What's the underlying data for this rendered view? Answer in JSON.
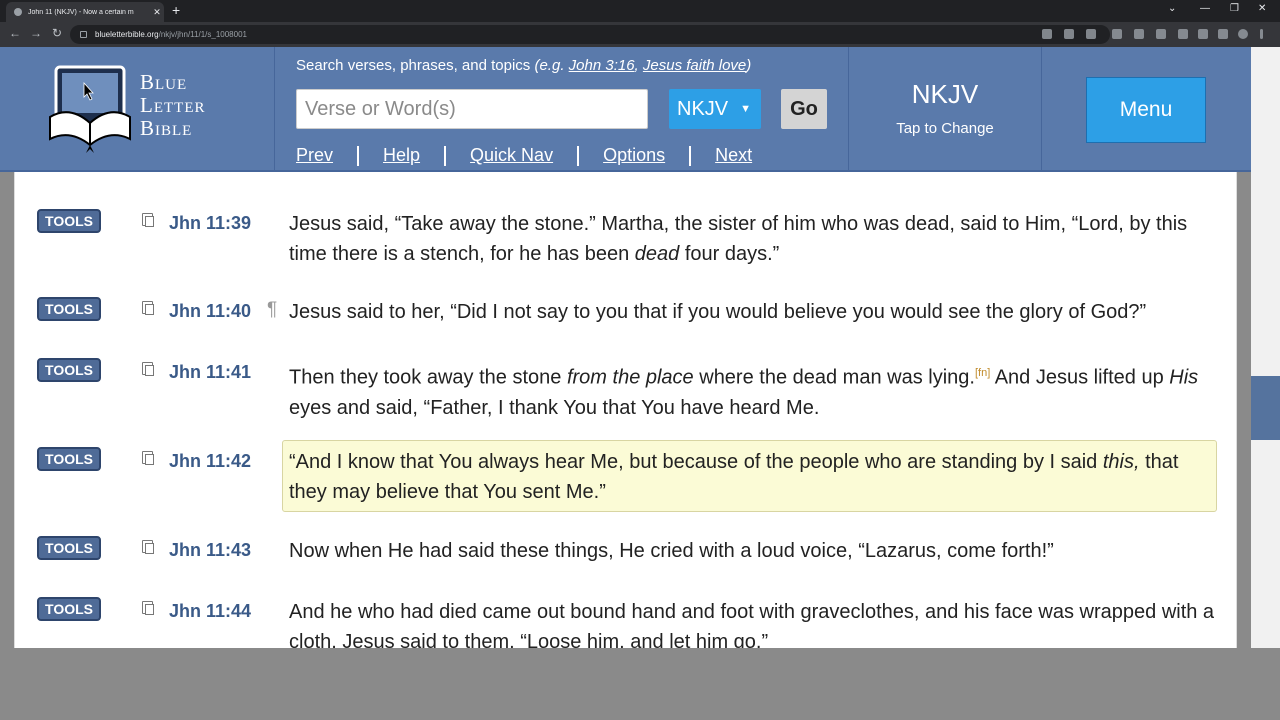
{
  "browser": {
    "tab_title": "John 11 (NKJV) - Now a certain m",
    "tab_close": "✕",
    "new_tab": "+",
    "url_host": "blueletterbible.org",
    "url_path": "/nkjv/jhn/11/1/s_1008001",
    "back": "←",
    "forward": "→",
    "reload": "↻"
  },
  "site": {
    "logo": {
      "line1": "Blue",
      "line2": "Letter",
      "line3": "Bible"
    },
    "search_hint_prefix": "Search verses, phrases, and topics ",
    "search_hint_eg": "(e.g. ",
    "search_hint_ex1": "John 3:16",
    "search_hint_comma": ", ",
    "search_hint_ex2": "Jesus faith love",
    "search_hint_end": ")",
    "search_placeholder": "Verse or Word(s)",
    "version_select": "NKJV",
    "go_label": "Go",
    "nav": {
      "prev": "Prev",
      "help": "Help",
      "quick_nav": "Quick Nav",
      "options": "Options",
      "next": "Next"
    },
    "version_code": "NKJV",
    "version_tap": "Tap to Change",
    "menu_label": "Menu"
  },
  "tools_label": "TOOLS",
  "pilcrow": "¶",
  "footnote_marker": "[fn]",
  "verses": [
    {
      "ref": "Jhn 11:39",
      "parts": [
        {
          "t": "Jesus said, “Take away the stone.” Martha, the sister of him who was dead, said to Him, “Lord, by this time there is a stench, for he has been "
        },
        {
          "i": "dead"
        },
        {
          "t": " four days.”"
        }
      ]
    },
    {
      "ref": "Jhn 11:40",
      "parts": [
        {
          "t": "Jesus said to her, “Did I not say to you that if you would believe you would see the glory of God?”"
        }
      ]
    },
    {
      "ref": "Jhn 11:41",
      "parts": [
        {
          "t": "Then they took away the stone "
        },
        {
          "i": "from the place"
        },
        {
          "t": " where the dead man was lying."
        },
        {
          "fn": "[fn]"
        },
        {
          "t": " And Jesus lifted up "
        },
        {
          "i": "His"
        },
        {
          "t": " eyes and said, “Father, I thank You that You have heard Me."
        }
      ]
    },
    {
      "ref": "Jhn 11:42",
      "parts": [
        {
          "t": "“And I know that You always hear Me, but because of the people who are standing by I said "
        },
        {
          "i": "this,"
        },
        {
          "t": " that they may believe that You sent Me.”"
        }
      ]
    },
    {
      "ref": "Jhn 11:43",
      "parts": [
        {
          "t": "Now when He had said these things, He cried with a loud voice, “Lazarus, come forth!”"
        }
      ]
    },
    {
      "ref": "Jhn 11:44",
      "parts": [
        {
          "t": "And he who had died came out bound hand and foot with graveclothes, and his face was wrapped with a cloth. Jesus said to them, “Loose him, and let him go.”"
        }
      ]
    }
  ],
  "colors": {
    "header": "#5a7aab",
    "accent": "#2d9fe6",
    "highlight": "#fbfbd6",
    "ref": "#3a5a88"
  }
}
